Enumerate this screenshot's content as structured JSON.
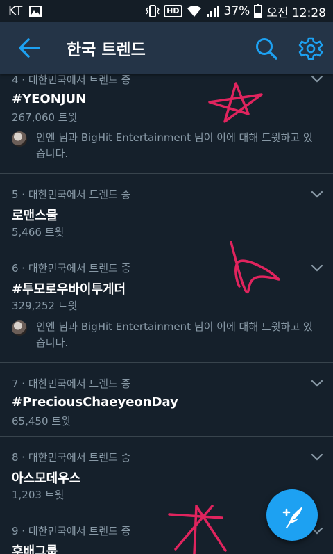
{
  "status_bar": {
    "carrier": "KT",
    "hd_label": "HD",
    "battery_percent": "37%",
    "time": "오전 12:28"
  },
  "header": {
    "title": "한국 트렌드"
  },
  "trends": [
    {
      "meta": "4 · 대한민국에서 트렌드 중",
      "name": "#YEONJUN",
      "count": "267,060 트윗",
      "context": "인엔 님과 BigHit Entertainment 님이 이에 대해 트윗하고 있습니다."
    },
    {
      "meta": "5 · 대한민국에서 트렌드 중",
      "name": "로맨스물",
      "count": "5,466 트윗"
    },
    {
      "meta": "6 · 대한민국에서 트렌드 중",
      "name": "#투모로우바이투게더",
      "count": "329,252 트윗",
      "context": "인엔 님과 BigHit Entertainment 님이 이에 대해 트윗하고 있습니다."
    },
    {
      "meta": "7 · 대한민국에서 트렌드 중",
      "name": "#PreciousChaeyeonDay",
      "count": "65,450 트윗"
    },
    {
      "meta": "8 · 대한민국에서 트렌드 중",
      "name": "아스모데우스",
      "count": "1,203 트윗"
    },
    {
      "meta": "9 · 대한민국에서 트렌드 중",
      "name": "후배그룹"
    }
  ],
  "colors": {
    "background": "#15202b",
    "app_bar": "#243447",
    "accent": "#1da1f2",
    "secondary_text": "#8899a6",
    "divider": "#38444d",
    "scribble": "#e0245e"
  },
  "icons": {
    "back": "arrow-left-icon",
    "search": "search-icon",
    "settings": "gear-icon",
    "compose": "compose-tweet-icon",
    "expand": "chevron-down-icon"
  }
}
